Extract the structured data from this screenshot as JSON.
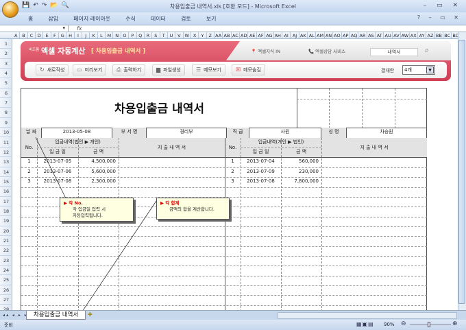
{
  "window": {
    "title": "차용입출금 내역서.xls  [호환 모드] - Microsoft Excel",
    "controls": "–  ▭  ✕"
  },
  "ribbon": {
    "tabs": [
      "홈",
      "삽입",
      "페이지 레이아웃",
      "수식",
      "데이터",
      "검토",
      "보기"
    ],
    "right_controls": "?  –  ▭  ✕"
  },
  "formula": {
    "fx": "fx",
    "namebox_arrow": "▾"
  },
  "columns": [
    "A",
    "B",
    "C",
    "D",
    "E",
    "F",
    "G",
    "H",
    "I",
    "J",
    "K",
    "L",
    "M",
    "N",
    "O",
    "P",
    "Q",
    "R",
    "S",
    "T",
    "U",
    "V",
    "W",
    "X",
    "Y",
    "Z",
    "AA",
    "AB",
    "AC",
    "AD",
    "AE",
    "AF",
    "AG",
    "AH",
    "AI",
    "AJ",
    "AK",
    "AL",
    "AM",
    "AN",
    "AO",
    "AP",
    "AQ",
    "AR",
    "AS",
    "AT",
    "AU",
    "AV",
    "AW",
    "AX",
    "AY",
    "AZ",
    "BB",
    "BC",
    "BD"
  ],
  "rows": [
    "1",
    "2",
    "3",
    "4",
    "5",
    "6",
    "7",
    "8",
    "9",
    "10",
    "11",
    "12",
    "13",
    "14",
    "15",
    "16",
    "17",
    "18",
    "19",
    "20",
    "21",
    "22",
    "23",
    "24",
    "25",
    "26",
    "27",
    "28"
  ],
  "banner": {
    "brand_small": "비즈폼",
    "brand": "엑셀 자동계산",
    "doc_name": "[ 차용입출금 내역서 ]",
    "tabs": [
      "엑셀지식 IN",
      "엑셀상담 서비스"
    ],
    "search_value": "내역서",
    "buttons": [
      {
        "label": "새로작성",
        "icon": "refresh-icon"
      },
      {
        "label": "미리보기",
        "icon": "monitor-icon"
      },
      {
        "label": "출력하기",
        "icon": "print-icon"
      },
      {
        "label": "파일생성",
        "icon": "folder-icon"
      },
      {
        "label": "메모보기",
        "icon": "memo-icon"
      },
      {
        "label": "메모숨김",
        "icon": "memo-hide-icon"
      }
    ],
    "approval_label": "결재란",
    "approval_value": "4개"
  },
  "doc": {
    "title": "차용입출금 내역서",
    "info": {
      "date_label": "날 짜",
      "date": "2013-05-08",
      "dept_label": "부 서 명",
      "dept": "경리부",
      "rank_label": "직 급",
      "rank": "사원",
      "name_label": "성 명",
      "name": "차승원"
    },
    "left": {
      "no": "No.",
      "group": "입금내역(법인 ▶ 개인)",
      "date_h": "입 금 일",
      "amount_h": "금    액",
      "memo_h": "지 출 내 역 서",
      "rows": [
        [
          "1",
          "2013-07-05",
          "4,500,000"
        ],
        [
          "2",
          "2013-07-06",
          "5,600,000"
        ],
        [
          "3",
          "2013-07-08",
          "2,300,000"
        ]
      ]
    },
    "right": {
      "no": "No.",
      "group": "입금내역(개인 ▶ 법인)",
      "date_h": "입 금 일",
      "amount_h": "금    액",
      "memo_h": "지 출 내 역 서",
      "rows": [
        [
          "1",
          "2013-07-04",
          "560,000"
        ],
        [
          "2",
          "2013-07-09",
          "230,000"
        ],
        [
          "3",
          "2013-07-08",
          "7,800,000"
        ]
      ]
    }
  },
  "callouts": [
    {
      "title": "▶ 각 No.",
      "lines": [
        "각 입금일 입력 시",
        "자동입력됩니다."
      ]
    },
    {
      "title": "▶ 각 합계",
      "lines": [
        "금액의 합을 계산합니다."
      ]
    }
  ],
  "sheet_tab": "차용입출금 내역서",
  "status": {
    "ready": "준비",
    "zoom": "90%"
  }
}
